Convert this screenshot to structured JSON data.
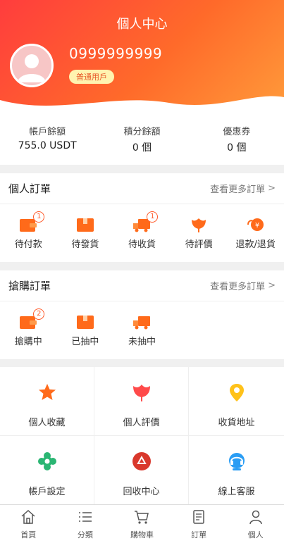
{
  "header": {
    "title": "個人中心",
    "phone": "0999999999",
    "badge": "普通用戶"
  },
  "stats": [
    {
      "label": "帳戶餘額",
      "value": "755.0 USDT"
    },
    {
      "label": "積分餘額",
      "value": "0 個"
    },
    {
      "label": "優惠券",
      "value": "0 個"
    }
  ],
  "orders": {
    "title": "個人訂單",
    "more": "查看更多訂單",
    "items": [
      {
        "label": "待付款",
        "icon": "wallet-icon",
        "count": "1"
      },
      {
        "label": "待發貨",
        "icon": "box-icon",
        "count": ""
      },
      {
        "label": "待收貨",
        "icon": "truck-icon",
        "count": "1"
      },
      {
        "label": "待評價",
        "icon": "flower-icon",
        "count": ""
      },
      {
        "label": "退款/退貨",
        "icon": "refund-icon",
        "count": ""
      }
    ]
  },
  "rush": {
    "title": "搶購訂單",
    "more": "查看更多訂單",
    "items": [
      {
        "label": "搶購中",
        "icon": "wallet-icon",
        "count": "2"
      },
      {
        "label": "已抽中",
        "icon": "box-icon",
        "count": ""
      },
      {
        "label": "未抽中",
        "icon": "truck-icon",
        "count": ""
      }
    ]
  },
  "grid": [
    {
      "label": "個人收藏",
      "icon": "star-icon"
    },
    {
      "label": "個人評價",
      "icon": "flower-icon"
    },
    {
      "label": "收貨地址",
      "icon": "location-pin-icon"
    },
    {
      "label": "帳戶設定",
      "icon": "gear-icon"
    },
    {
      "label": "回收中心",
      "icon": "recycle-icon"
    },
    {
      "label": "線上客服",
      "icon": "headset-icon"
    }
  ],
  "tabs": [
    {
      "label": "首頁",
      "icon": "home-icon"
    },
    {
      "label": "分類",
      "icon": "list-icon"
    },
    {
      "label": "購物車",
      "icon": "cart-icon"
    },
    {
      "label": "訂單",
      "icon": "order-icon"
    },
    {
      "label": "個人",
      "icon": "user-icon"
    }
  ],
  "colors": {
    "accent": "#ff6a1a",
    "header_start": "#ff3d3d",
    "header_end": "#ff9b3a",
    "badge_bg": "#fff3b0"
  }
}
